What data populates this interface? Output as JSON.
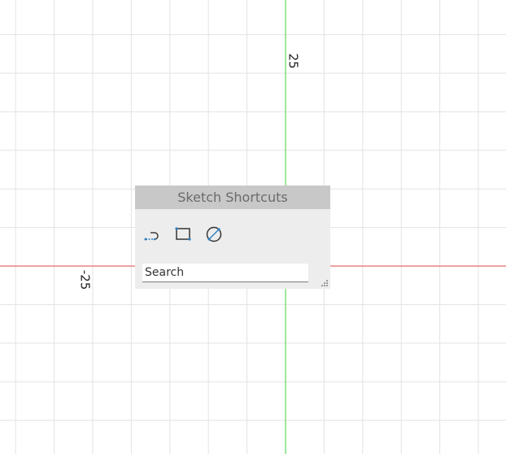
{
  "viewport": {
    "axis_label_top": "25",
    "axis_label_left": "-25",
    "colors": {
      "background": "#ffffff",
      "grid": "#e3e3e3",
      "vertical_axis": "#7fe07f",
      "horizontal_axis": "#e86a6a"
    }
  },
  "sketch_shortcuts": {
    "title": "Sketch Shortcuts",
    "tools": [
      {
        "icon": "line-arc-icon"
      },
      {
        "icon": "rectangle-icon"
      },
      {
        "icon": "circle-diameter-icon"
      }
    ],
    "search": {
      "placeholder": "Search",
      "value": ""
    },
    "accent_color": "#2f7fc1"
  }
}
